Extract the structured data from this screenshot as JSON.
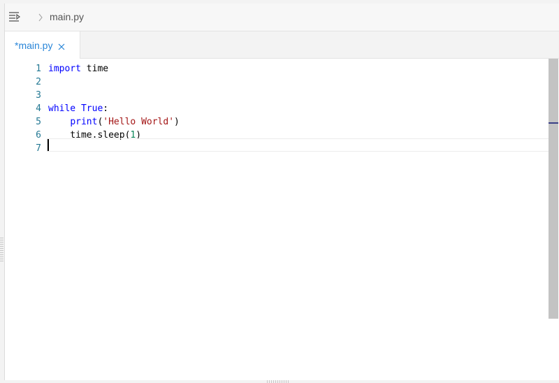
{
  "toolbar": {
    "menu_icon": "menu-arrow-icon",
    "chevron_icon": "chevron-right-icon",
    "breadcrumb_file": "main.py"
  },
  "tab": {
    "label": "*main.py",
    "close_icon": "close-icon"
  },
  "editor": {
    "line_numbers": [
      "1",
      "2",
      "3",
      "4",
      "5",
      "6",
      "7"
    ],
    "lines": [
      [
        {
          "t": "import",
          "c": "kw"
        },
        {
          "t": " time",
          "c": ""
        }
      ],
      [],
      [],
      [
        {
          "t": "while",
          "c": "kw"
        },
        {
          "t": " ",
          "c": ""
        },
        {
          "t": "True",
          "c": "kw"
        },
        {
          "t": ":",
          "c": ""
        }
      ],
      [
        {
          "t": "    ",
          "c": ""
        },
        {
          "t": "print",
          "c": "kw"
        },
        {
          "t": "(",
          "c": ""
        },
        {
          "t": "'Hello World'",
          "c": "str"
        },
        {
          "t": ")",
          "c": ""
        }
      ],
      [
        {
          "t": "    time.sleep(",
          "c": ""
        },
        {
          "t": "1",
          "c": "num"
        },
        {
          "t": ")",
          "c": ""
        }
      ],
      []
    ],
    "cursor_line": 7
  },
  "colors": {
    "tab_label": "#2a86d8",
    "line_number": "#237893",
    "keyword": "#0000ff",
    "string": "#a31515",
    "number": "#098658"
  }
}
